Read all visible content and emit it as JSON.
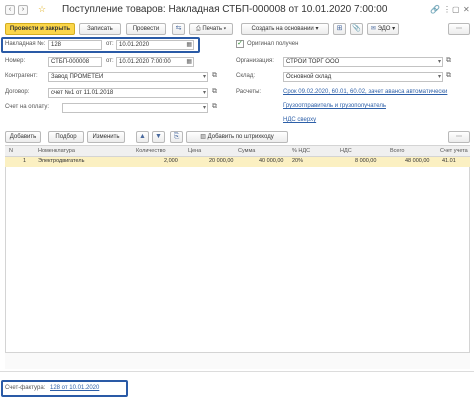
{
  "window": {
    "title": "Поступление товаров: Накладная СТБП-000008 от 10.01.2020 7:00:00"
  },
  "toolbar": {
    "post_close": "Провести и закрыть",
    "write": "Записать",
    "post": "Провести",
    "print": "Печать",
    "create_based_on": "Создать на основании",
    "edo": "ЭДО"
  },
  "form": {
    "invoice_label": "Накладная №:",
    "invoice_value": "128",
    "invoice_date_label": "от:",
    "invoice_date": "10.01.2020",
    "original_received": "Оригинал получен",
    "number_label": "Номер:",
    "number_value": "СТБП-000008",
    "number_date_label": "от:",
    "number_date": "10.01.2020  7:00:00",
    "org_label": "Организация:",
    "org_value": "СТРОЙ ТОРГ ООО",
    "contractor_label": "Контрагент:",
    "contractor_value": "Завод ПРОМЕТЕЙ",
    "warehouse_label": "Склад:",
    "warehouse_value": "Основной склад",
    "contract_label": "Договор:",
    "contract_value": "счет №1 от 11.01.2018",
    "settlements_label": "Расчеты:",
    "settlements_link": "Срок 09.02.2020, 60.01, 60.02, зачет аванса автоматически",
    "invoice_for_payment_label": "Счет на оплату:",
    "shipper_link": "Грузоотправитель и грузополучатель",
    "vat_link": "НДС сверху"
  },
  "table_toolbar": {
    "add": "Добавить",
    "pick": "Подбор",
    "change": "Изменить",
    "add_barcode": "Добавить по штрихкоду"
  },
  "table": {
    "columns": [
      "N",
      "Номенклатура",
      "Количество",
      "Цена",
      "Сумма",
      "% НДС",
      "НДС",
      "Всего",
      "Счет учета"
    ],
    "rows": [
      {
        "n": "1",
        "item": "Электродвигатель",
        "qty": "2,000",
        "price": "20 000,00",
        "sum": "40 000,00",
        "vat_rate": "20%",
        "vat": "8 000,00",
        "total": "48 000,00",
        "account": "41.01"
      }
    ]
  },
  "footer": {
    "invoice_label": "Счет-фактура:",
    "invoice_link": "128 от 10.01.2020"
  },
  "colors": {
    "primary_button": "#fbd64a",
    "highlight_frame": "#2a5aa6",
    "selected_row": "#fbf0c2",
    "link": "#2d5fa8"
  }
}
